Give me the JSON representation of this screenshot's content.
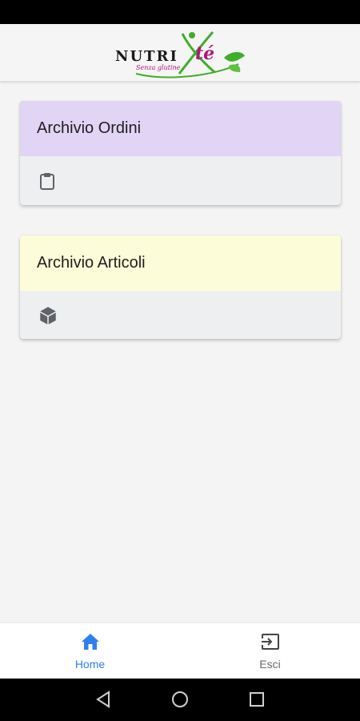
{
  "app": {
    "logo": {
      "wordmark_part1": "NUTRI",
      "wordmark_part2": "té",
      "tagline": "Senza glutine",
      "brand_colors": {
        "green": "#3fae29",
        "magenta": "#b0167a"
      }
    }
  },
  "cards": [
    {
      "title": "Archivio Ordini",
      "icon": "clipboard-icon",
      "header_color": "#e1d4f5"
    },
    {
      "title": "Archivio Articoli",
      "icon": "box-icon",
      "header_color": "#fdfcd9"
    }
  ],
  "bottom_nav": {
    "items": [
      {
        "label": "Home",
        "icon": "home-icon",
        "active": true
      },
      {
        "label": "Esci",
        "icon": "exit-icon",
        "active": false
      }
    ],
    "active_color": "#2f80ed"
  },
  "system_nav": {
    "buttons": [
      "back-icon",
      "home-circle-icon",
      "recents-icon"
    ]
  }
}
